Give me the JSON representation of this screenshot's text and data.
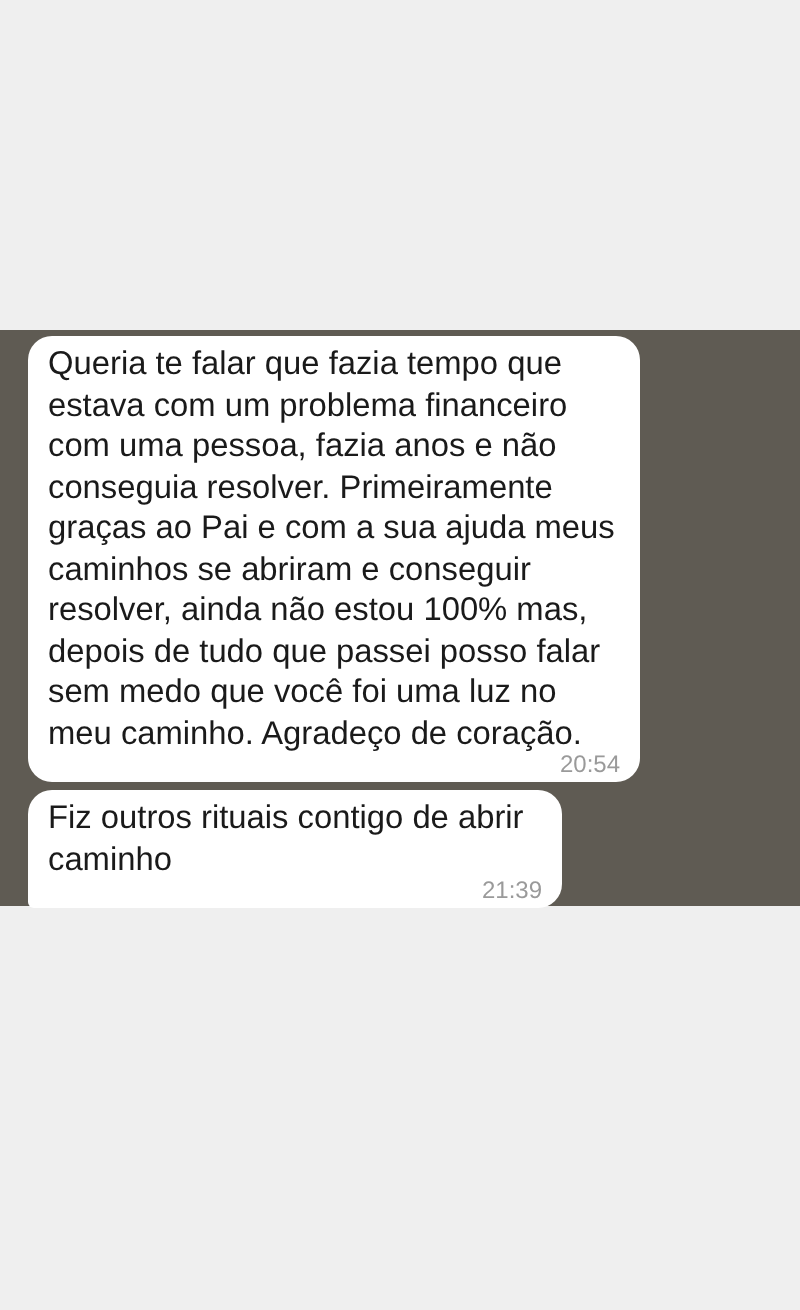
{
  "messages": [
    {
      "text": "Queria te falar que fazia tempo que estava com um problema financeiro com uma pessoa, fazia anos e não conseguia resolver. Primeiramente graças ao Pai e com a sua ajuda meus caminhos se abriram e conseguir resolver, ainda não estou 100% mas, depois de tudo que passei posso falar sem medo que você foi uma luz no meu caminho. Agradeço de coração.",
      "time": "20:54"
    },
    {
      "text": "Fiz outros rituais contigo de abrir caminho",
      "time": "21:39"
    }
  ]
}
